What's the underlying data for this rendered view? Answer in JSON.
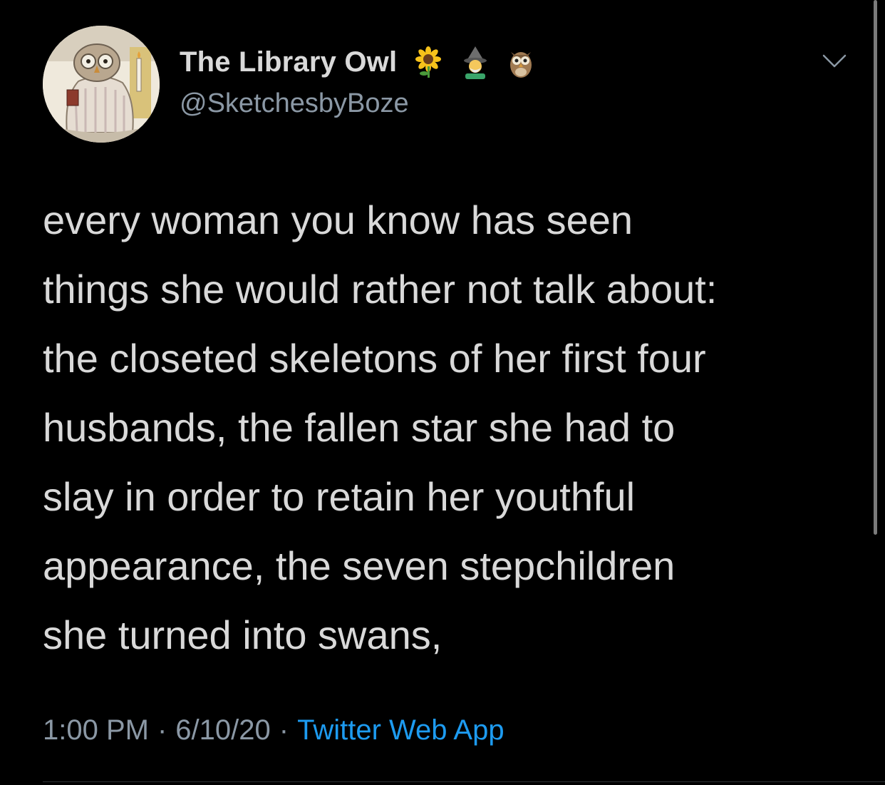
{
  "author": {
    "display_name": "The Library Owl",
    "handle": "@SketchesbyBoze",
    "name_emojis": [
      "sunflower-emoji",
      "mage-emoji",
      "owl-emoji"
    ]
  },
  "tweet": {
    "lines": [
      "every woman you know has seen",
      "things she would rather not talk about:",
      "the closeted skeletons of her first four",
      "husbands, the fallen star she had to",
      "slay in order to retain her youthful",
      "appearance, the seven stepchildren",
      "she turned into swans,"
    ]
  },
  "meta": {
    "time": "1:00 PM",
    "separator": "·",
    "date": "6/10/20",
    "source": "Twitter Web App"
  },
  "colors": {
    "background": "#000000",
    "text": "#d9d9d9",
    "secondary": "#8b98a5",
    "link": "#1d9bf0"
  },
  "icons": {
    "more": "chevron-down-icon"
  }
}
